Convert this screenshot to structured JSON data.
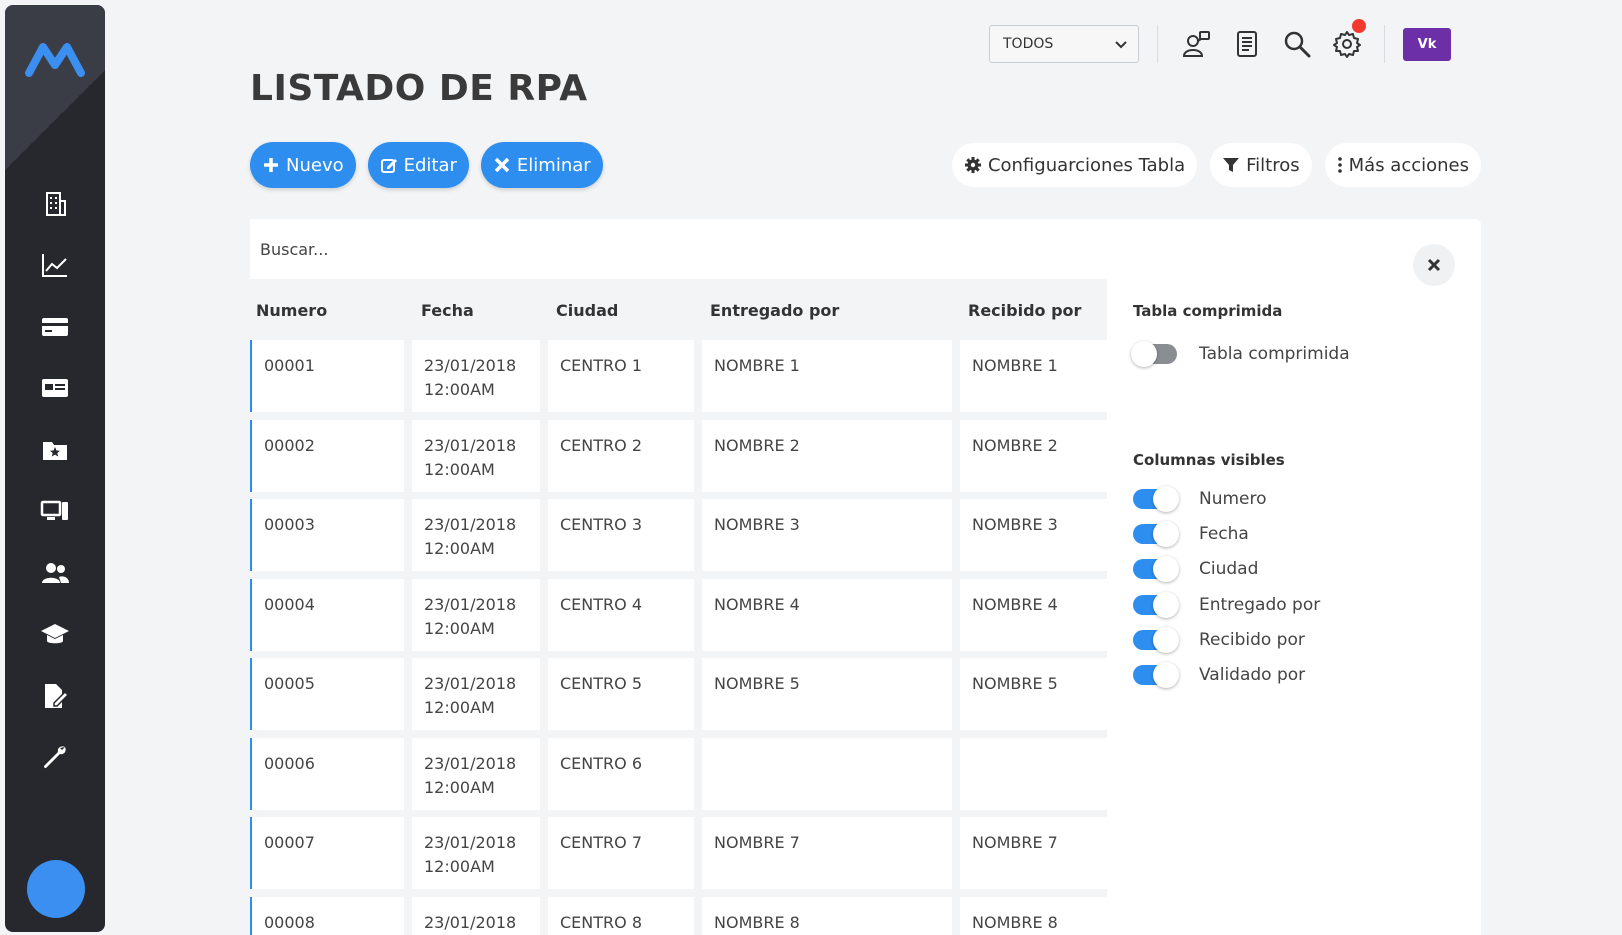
{
  "header": {
    "filter_select": {
      "value": "TODOS"
    },
    "icons": [
      "user-network-icon",
      "document-list-icon",
      "search-icon",
      "gear-icon"
    ],
    "user_initials": "Vk",
    "colors": {
      "accent": "#2d8ef0",
      "sidebar": "#26282e",
      "user_badge": "#6c2fa8",
      "notification": "#f23a2f"
    }
  },
  "sidebar": {
    "items": [
      "building-icon",
      "line-chart-icon",
      "credit-card-icon",
      "id-card-icon",
      "folder-star-icon",
      "devices-icon",
      "users-icon",
      "graduation-cap-icon",
      "file-edit-icon",
      "wrench-icon"
    ]
  },
  "page": {
    "title": "LISTADO DE RPA"
  },
  "actions": {
    "nuevo": "Nuevo",
    "editar": "Editar",
    "eliminar": "Eliminar",
    "config_table": "Configuarciones Tabla",
    "filtros": "Filtros",
    "mas_acciones": "Más acciones"
  },
  "search": {
    "placeholder": "Buscar..."
  },
  "table": {
    "columns": [
      "Numero",
      "Fecha",
      "Ciudad",
      "Entregado por",
      "Recibido por"
    ],
    "rows": [
      {
        "numero": "00001",
        "fecha": "23/01/2018",
        "hora": "12:00AM",
        "ciudad": "CENTRO 1",
        "entregado": "NOMBRE 1",
        "recibido": "NOMBRE 1"
      },
      {
        "numero": "00002",
        "fecha": "23/01/2018",
        "hora": "12:00AM",
        "ciudad": "CENTRO 2",
        "entregado": "NOMBRE 2",
        "recibido": "NOMBRE 2"
      },
      {
        "numero": "00003",
        "fecha": "23/01/2018",
        "hora": "12:00AM",
        "ciudad": "CENTRO 3",
        "entregado": "NOMBRE 3",
        "recibido": "NOMBRE 3"
      },
      {
        "numero": "00004",
        "fecha": "23/01/2018",
        "hora": "12:00AM",
        "ciudad": "CENTRO 4",
        "entregado": "NOMBRE 4",
        "recibido": "NOMBRE 4"
      },
      {
        "numero": "00005",
        "fecha": "23/01/2018",
        "hora": "12:00AM",
        "ciudad": "CENTRO 5",
        "entregado": "NOMBRE 5",
        "recibido": "NOMBRE 5"
      },
      {
        "numero": "00006",
        "fecha": "23/01/2018",
        "hora": "12:00AM",
        "ciudad": "CENTRO 6",
        "entregado": "",
        "recibido": ""
      },
      {
        "numero": "00007",
        "fecha": "23/01/2018",
        "hora": "12:00AM",
        "ciudad": "CENTRO 7",
        "entregado": "NOMBRE 7",
        "recibido": "NOMBRE 7"
      },
      {
        "numero": "00008",
        "fecha": "23/01/2018",
        "hora": "",
        "ciudad": "CENTRO 8",
        "entregado": "NOMBRE 8",
        "recibido": "NOMBRE 8"
      }
    ]
  },
  "config_panel": {
    "compressed_title": "Tabla comprimida",
    "compressed_toggle": {
      "label": "Tabla comprimida",
      "on": false
    },
    "visible_title": "Columnas visibles",
    "visible_columns": [
      {
        "label": "Numero",
        "on": true
      },
      {
        "label": "Fecha",
        "on": true
      },
      {
        "label": "Ciudad",
        "on": true
      },
      {
        "label": "Entregado por",
        "on": true
      },
      {
        "label": "Recibido por",
        "on": true
      },
      {
        "label": "Validado por",
        "on": true
      }
    ]
  }
}
